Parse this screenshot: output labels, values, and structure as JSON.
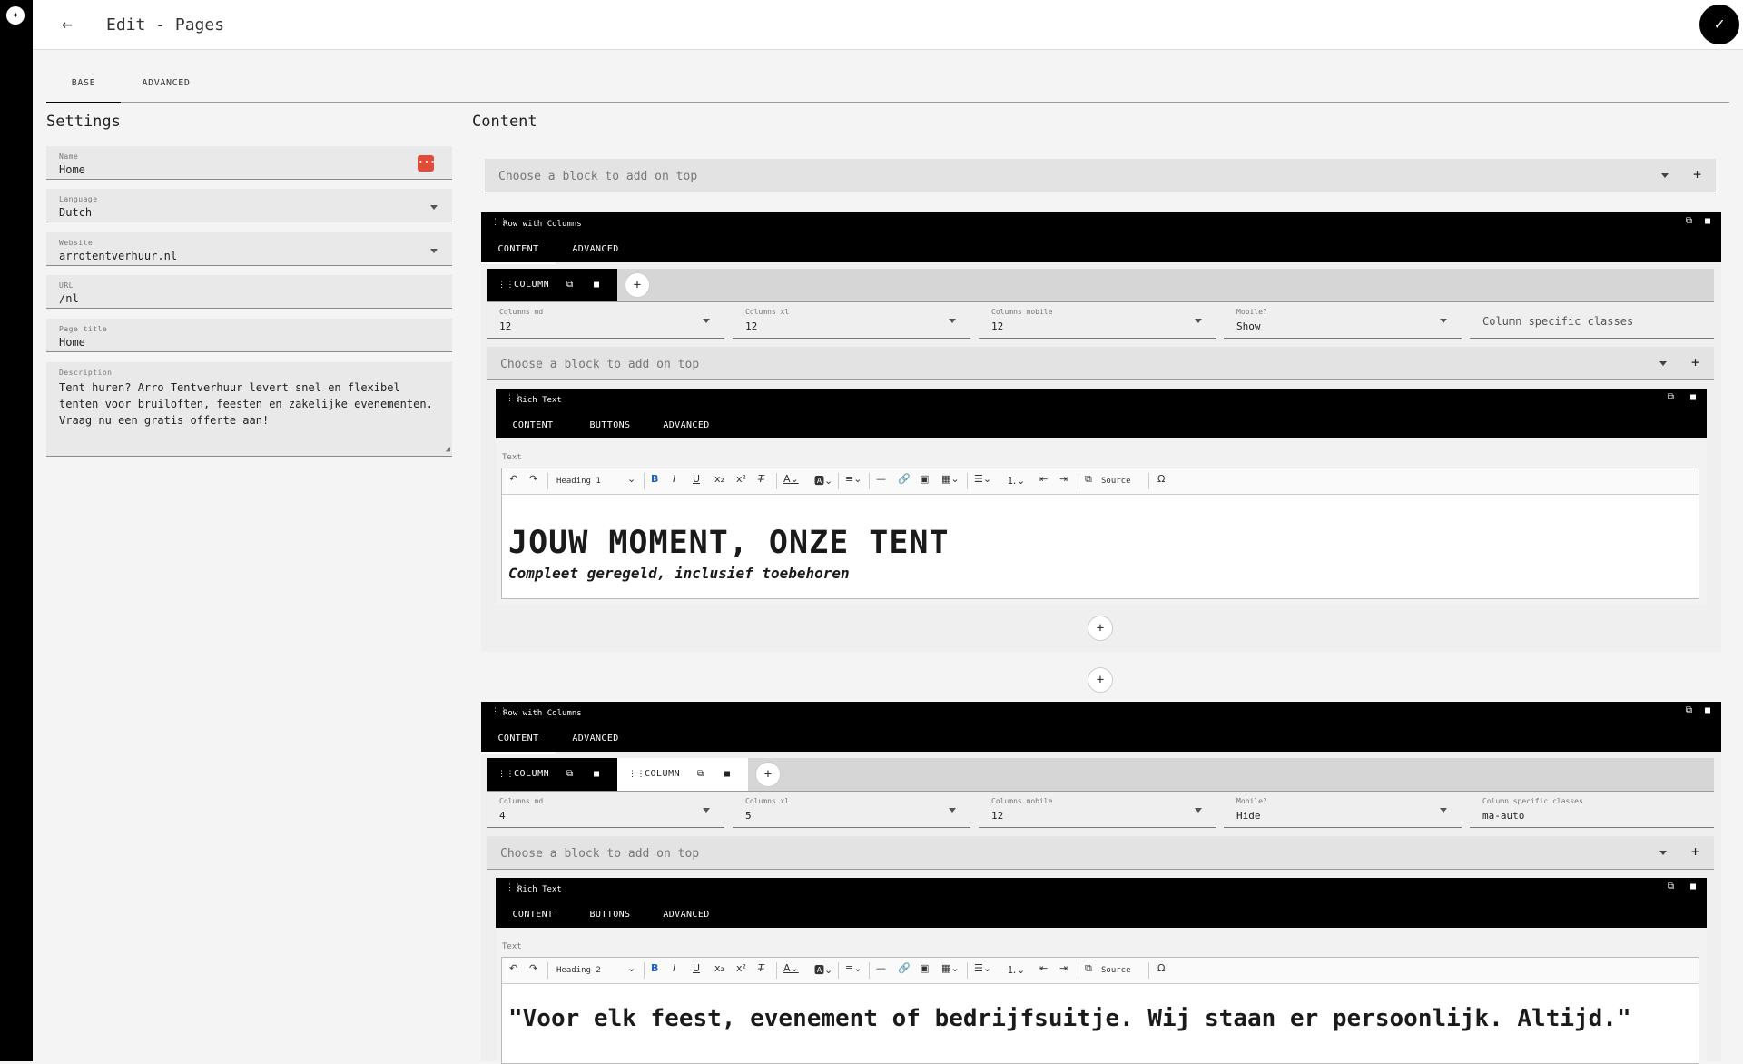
{
  "app": {
    "logo_icon": "brand-logo-icon"
  },
  "header": {
    "title": "Edit - Pages",
    "back_icon": "←",
    "save_icon": "✓"
  },
  "tabs": [
    "BASE",
    "ADVANCED"
  ],
  "settings": {
    "heading": "Settings",
    "name": {
      "label": "Name",
      "value": "Home"
    },
    "language": {
      "label": "Language",
      "value": "Dutch"
    },
    "website": {
      "label": "Website",
      "value": "arrotentverhuur.nl"
    },
    "url": {
      "label": "URL",
      "value": "/nl"
    },
    "page_title": {
      "label": "Page title",
      "value": "Home"
    },
    "description": {
      "label": "Description",
      "value": "Tent huren? Arro Tentverhuur levert snel en flexibel tenten voor bruiloften, feesten en zakelijke evenementen. Vraag nu een gratis offerte aan!"
    }
  },
  "content": {
    "heading": "Content",
    "add_top_placeholder": "Choose a block to add on top",
    "rows": [
      {
        "title": "Row with Columns",
        "tabs": [
          "CONTENT",
          "ADVANCED"
        ],
        "columns": [
          "COLUMN"
        ],
        "fields": [
          {
            "label": "Columns md",
            "value": "12"
          },
          {
            "label": "Columns xl",
            "value": "12"
          },
          {
            "label": "Columns mobile",
            "value": "12"
          },
          {
            "label": "Mobile?",
            "value": "Show"
          },
          {
            "label": "",
            "placeholder": "Column specific classes"
          }
        ],
        "block_placeholder": "Choose a block to add on top",
        "richtext": {
          "title": "Rich Text",
          "tabs": [
            "CONTENT",
            "BUTTONS",
            "ADVANCED"
          ],
          "text_label": "Text",
          "heading_select": "Heading 1",
          "source_label": "Source",
          "heading": "JOUW MOMENT, ONZE TENT",
          "subheading": "Compleet geregeld, inclusief toebehoren"
        }
      },
      {
        "title": "Row with Columns",
        "tabs": [
          "CONTENT",
          "ADVANCED"
        ],
        "columns": [
          "COLUMN",
          "COLUMN"
        ],
        "fields": [
          {
            "label": "Columns md",
            "value": "4"
          },
          {
            "label": "Columns xl",
            "value": "5"
          },
          {
            "label": "Columns mobile",
            "value": "12"
          },
          {
            "label": "Mobile?",
            "value": "Hide"
          },
          {
            "label": "Column specific classes",
            "value": "ma-auto"
          }
        ],
        "block_placeholder": "Choose a block to add on top",
        "richtext": {
          "title": "Rich Text",
          "tabs": [
            "CONTENT",
            "BUTTONS",
            "ADVANCED"
          ],
          "text_label": "Text",
          "heading_select": "Heading 2",
          "source_label": "Source",
          "heading": "\"Voor elk feest, evenement of bedrijfsuitje. Wij staan er persoonlijk. Altijd.\""
        }
      }
    ]
  }
}
